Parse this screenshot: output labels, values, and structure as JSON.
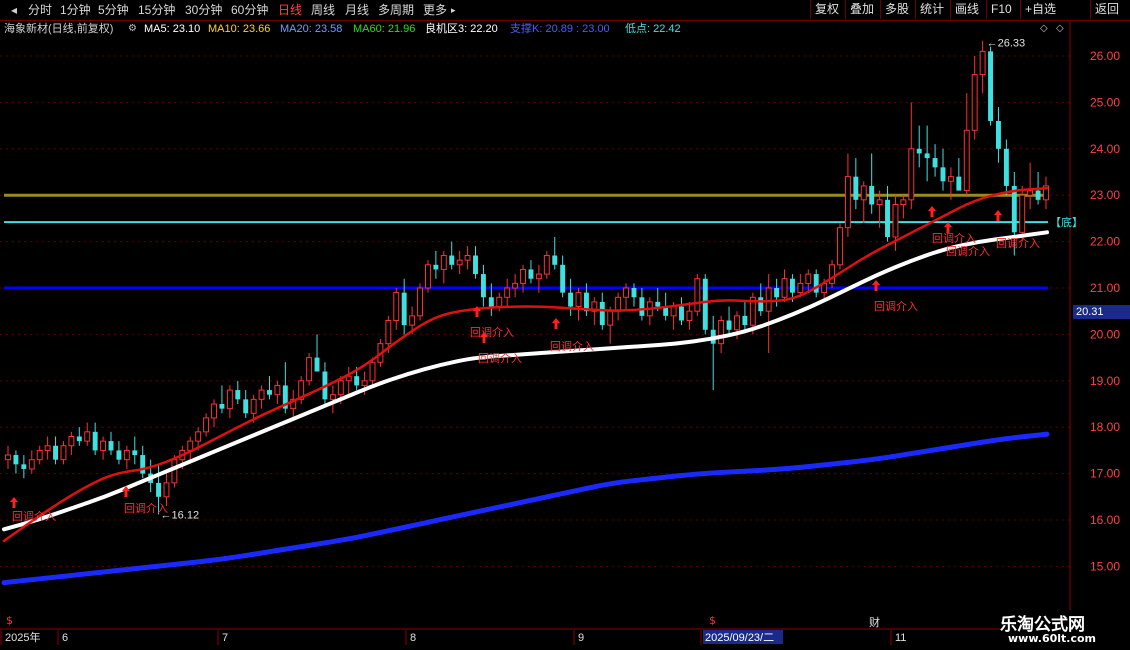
{
  "toolbar": {
    "tabs": [
      "分时",
      "1分钟",
      "5分钟",
      "15分钟",
      "30分钟",
      "60分钟",
      "日线",
      "周线",
      "月线",
      "多周期",
      "更多"
    ],
    "active_tab": "日线",
    "right_buttons": [
      "复权",
      "叠加",
      "多股",
      "统计",
      "画线",
      "F10",
      "+自选",
      "返回"
    ]
  },
  "info": {
    "stock": "海象新材(日线,前复权)",
    "ma5": "MA5: 23.10",
    "ma10": "MA10: 23.66",
    "ma20": "MA20: 23.58",
    "ma60": "MA60: 21.96",
    "liangji": "良机区3: 22.20",
    "support": "支撑K: 20.89 : 23.00",
    "dipoint": "低点: 22.42"
  },
  "colors": {
    "up": "#ff3030",
    "down": "#40e0e0",
    "ma_white": "#ffffff",
    "ma_red": "#e01010",
    "ma_blue": "#1a2aff",
    "line_olive": "#9a8a20",
    "line_cyan": "#40e0e0",
    "line_blue": "#0000ff",
    "axis": "#8b0000"
  },
  "chart_data": {
    "type": "candlestick",
    "y_ticks": [
      "26.00",
      "25.00",
      "24.00",
      "23.00",
      "22.00",
      "21.00",
      "20.00",
      "19.00",
      "18.00",
      "17.00",
      "16.00",
      "15.00"
    ],
    "ylim": [
      14.4,
      26.8
    ],
    "x_labels": [
      "2025年",
      "6",
      "7",
      "8",
      "9",
      "2025/09/23/二",
      "11"
    ],
    "high_label": "26.33",
    "low_label": "16.12",
    "current_price": "20.31",
    "horizontal_lines": [
      {
        "value": 23.0,
        "color": "olive"
      },
      {
        "value": 22.42,
        "color": "cyan",
        "label": "底"
      },
      {
        "value": 21.0,
        "color": "blue"
      }
    ],
    "signal_label": "回调介入",
    "special_markers": [
      "财"
    ],
    "candles": [
      [
        17.3,
        17.6,
        17.1,
        17.4
      ],
      [
        17.4,
        17.5,
        17.0,
        17.2
      ],
      [
        17.2,
        17.4,
        16.9,
        17.1
      ],
      [
        17.1,
        17.5,
        17.0,
        17.3
      ],
      [
        17.3,
        17.6,
        17.2,
        17.5
      ],
      [
        17.5,
        17.8,
        17.3,
        17.6
      ],
      [
        17.6,
        17.8,
        17.2,
        17.3
      ],
      [
        17.3,
        17.7,
        17.2,
        17.6
      ],
      [
        17.6,
        17.9,
        17.4,
        17.8
      ],
      [
        17.8,
        18.0,
        17.6,
        17.7
      ],
      [
        17.7,
        18.1,
        17.6,
        17.9
      ],
      [
        17.9,
        18.1,
        17.4,
        17.5
      ],
      [
        17.5,
        17.8,
        17.3,
        17.7
      ],
      [
        17.7,
        17.9,
        17.4,
        17.5
      ],
      [
        17.5,
        17.7,
        17.2,
        17.3
      ],
      [
        17.3,
        17.6,
        17.1,
        17.5
      ],
      [
        17.5,
        17.8,
        17.2,
        17.4
      ],
      [
        17.4,
        17.6,
        16.9,
        17.0
      ],
      [
        17.0,
        17.3,
        16.6,
        16.8
      ],
      [
        16.8,
        17.2,
        16.12,
        16.5
      ],
      [
        16.5,
        17.0,
        16.3,
        16.8
      ],
      [
        16.8,
        17.4,
        16.7,
        17.3
      ],
      [
        17.3,
        17.6,
        17.1,
        17.5
      ],
      [
        17.5,
        17.8,
        17.3,
        17.7
      ],
      [
        17.7,
        18.0,
        17.5,
        17.9
      ],
      [
        17.9,
        18.3,
        17.8,
        18.2
      ],
      [
        18.2,
        18.6,
        18.0,
        18.5
      ],
      [
        18.5,
        18.9,
        18.3,
        18.4
      ],
      [
        18.4,
        18.9,
        18.2,
        18.8
      ],
      [
        18.8,
        19.0,
        18.5,
        18.6
      ],
      [
        18.6,
        18.8,
        18.2,
        18.3
      ],
      [
        18.3,
        18.7,
        18.1,
        18.6
      ],
      [
        18.6,
        18.9,
        18.4,
        18.8
      ],
      [
        18.8,
        19.1,
        18.6,
        18.7
      ],
      [
        18.7,
        19.0,
        18.5,
        18.9
      ],
      [
        18.9,
        19.4,
        18.3,
        18.4
      ],
      [
        18.4,
        18.8,
        18.2,
        18.6
      ],
      [
        18.6,
        19.1,
        18.5,
        19.0
      ],
      [
        19.0,
        19.6,
        18.9,
        19.5
      ],
      [
        19.5,
        20.0,
        19.3,
        19.2
      ],
      [
        19.2,
        19.4,
        18.5,
        18.6
      ],
      [
        18.6,
        18.9,
        18.3,
        18.7
      ],
      [
        18.7,
        19.1,
        18.5,
        19.0
      ],
      [
        19.0,
        19.3,
        18.7,
        19.1
      ],
      [
        19.1,
        19.3,
        18.8,
        18.9
      ],
      [
        18.9,
        19.2,
        18.7,
        19.0
      ],
      [
        19.0,
        19.5,
        18.9,
        19.4
      ],
      [
        19.4,
        19.9,
        19.3,
        19.8
      ],
      [
        19.8,
        20.4,
        19.6,
        20.3
      ],
      [
        20.3,
        21.0,
        20.1,
        20.9
      ],
      [
        20.9,
        21.2,
        20.0,
        20.2
      ],
      [
        20.2,
        20.6,
        20.0,
        20.4
      ],
      [
        20.4,
        21.1,
        20.3,
        21.0
      ],
      [
        21.0,
        21.6,
        20.9,
        21.5
      ],
      [
        21.5,
        21.8,
        21.2,
        21.4
      ],
      [
        21.4,
        21.8,
        21.1,
        21.7
      ],
      [
        21.7,
        22.0,
        21.4,
        21.5
      ],
      [
        21.5,
        21.8,
        21.3,
        21.6
      ],
      [
        21.6,
        21.9,
        21.4,
        21.7
      ],
      [
        21.7,
        21.9,
        21.2,
        21.3
      ],
      [
        21.3,
        21.5,
        20.6,
        20.8
      ],
      [
        20.8,
        21.1,
        20.4,
        20.6
      ],
      [
        20.6,
        20.9,
        20.5,
        20.8
      ],
      [
        20.8,
        21.2,
        20.6,
        21.0
      ],
      [
        21.0,
        21.3,
        20.8,
        21.1
      ],
      [
        21.1,
        21.5,
        20.9,
        21.4
      ],
      [
        21.4,
        21.6,
        21.1,
        21.2
      ],
      [
        21.2,
        21.5,
        20.9,
        21.3
      ],
      [
        21.3,
        21.8,
        21.2,
        21.7
      ],
      [
        21.7,
        22.1,
        21.4,
        21.5
      ],
      [
        21.5,
        21.7,
        20.8,
        20.9
      ],
      [
        20.9,
        21.2,
        20.4,
        20.6
      ],
      [
        20.6,
        21.0,
        20.3,
        20.9
      ],
      [
        20.9,
        21.1,
        20.4,
        20.5
      ],
      [
        20.5,
        20.8,
        20.2,
        20.7
      ],
      [
        20.7,
        20.9,
        20.1,
        20.2
      ],
      [
        20.2,
        20.6,
        19.8,
        20.5
      ],
      [
        20.5,
        20.9,
        20.3,
        20.8
      ],
      [
        20.8,
        21.1,
        20.5,
        21.0
      ],
      [
        21.0,
        21.1,
        20.6,
        20.8
      ],
      [
        20.8,
        21.0,
        20.3,
        20.4
      ],
      [
        20.4,
        20.8,
        20.2,
        20.7
      ],
      [
        20.7,
        21.0,
        20.5,
        20.6
      ],
      [
        20.6,
        20.9,
        20.3,
        20.4
      ],
      [
        20.4,
        20.7,
        20.1,
        20.6
      ],
      [
        20.6,
        20.8,
        20.2,
        20.3
      ],
      [
        20.3,
        20.7,
        20.1,
        20.5
      ],
      [
        20.5,
        21.3,
        20.4,
        21.2
      ],
      [
        21.2,
        21.3,
        20.0,
        20.1
      ],
      [
        20.1,
        20.4,
        18.8,
        19.8
      ],
      [
        19.8,
        20.4,
        19.6,
        20.3
      ],
      [
        20.3,
        20.6,
        20.0,
        20.1
      ],
      [
        20.1,
        20.5,
        19.9,
        20.4
      ],
      [
        20.4,
        20.7,
        20.1,
        20.2
      ],
      [
        20.2,
        20.9,
        20.0,
        20.8
      ],
      [
        20.8,
        21.1,
        20.4,
        20.5
      ],
      [
        20.5,
        21.3,
        19.6,
        21.0
      ],
      [
        21.0,
        21.2,
        20.6,
        20.8
      ],
      [
        20.8,
        21.4,
        20.7,
        21.2
      ],
      [
        21.2,
        21.3,
        20.7,
        20.9
      ],
      [
        20.9,
        21.3,
        20.8,
        21.1
      ],
      [
        21.1,
        21.4,
        20.9,
        21.3
      ],
      [
        21.3,
        21.4,
        20.8,
        20.9
      ],
      [
        20.9,
        21.2,
        20.7,
        21.1
      ],
      [
        21.1,
        21.6,
        21.0,
        21.5
      ],
      [
        21.5,
        22.4,
        21.4,
        22.3
      ],
      [
        22.3,
        23.9,
        22.1,
        23.4
      ],
      [
        23.4,
        23.8,
        22.7,
        22.9
      ],
      [
        22.9,
        23.3,
        22.4,
        23.2
      ],
      [
        23.2,
        23.9,
        22.6,
        22.8
      ],
      [
        22.8,
        23.1,
        22.3,
        22.9
      ],
      [
        22.9,
        23.2,
        22.0,
        22.1
      ],
      [
        22.1,
        23.0,
        21.8,
        22.8
      ],
      [
        22.8,
        23.0,
        22.5,
        22.9
      ],
      [
        22.9,
        25.0,
        22.7,
        24.0
      ],
      [
        24.0,
        24.5,
        23.6,
        23.9
      ],
      [
        23.9,
        24.5,
        23.3,
        23.8
      ],
      [
        23.8,
        24.1,
        23.4,
        23.6
      ],
      [
        23.6,
        24.0,
        23.1,
        23.3
      ],
      [
        23.3,
        23.6,
        22.9,
        23.4
      ],
      [
        23.4,
        23.8,
        23.1,
        23.1
      ],
      [
        23.1,
        25.2,
        23.0,
        24.4
      ],
      [
        24.4,
        26.0,
        24.2,
        25.6
      ],
      [
        25.6,
        26.33,
        25.2,
        26.1
      ],
      [
        26.1,
        26.2,
        24.5,
        24.6
      ],
      [
        24.6,
        24.9,
        23.7,
        24.0
      ],
      [
        24.0,
        24.2,
        23.0,
        23.2
      ],
      [
        23.2,
        23.5,
        21.7,
        22.2
      ],
      [
        22.2,
        23.2,
        22.0,
        23.0
      ],
      [
        23.0,
        23.7,
        22.7,
        23.1
      ],
      [
        23.1,
        23.5,
        22.8,
        22.9
      ],
      [
        22.9,
        23.4,
        22.7,
        23.2
      ]
    ],
    "ma_white": [
      15.8,
      16.0,
      16.25,
      16.5,
      16.8,
      17.1,
      17.4,
      17.7,
      18.0,
      18.3,
      18.6,
      18.9,
      19.15,
      19.35,
      19.5,
      19.55,
      19.6,
      19.65,
      19.7,
      19.75,
      19.8,
      19.9,
      20.05,
      20.3,
      20.6,
      20.95,
      21.3,
      21.6,
      21.85,
      22.0,
      22.1,
      22.2
    ],
    "ma_red": [
      15.55,
      16.1,
      16.6,
      17.0,
      17.1,
      17.4,
      17.8,
      18.2,
      18.55,
      18.9,
      19.3,
      19.9,
      20.4,
      20.55,
      20.6,
      20.6,
      20.55,
      20.5,
      20.55,
      20.65,
      20.75,
      20.7,
      20.75,
      21.2,
      21.7,
      22.1,
      22.5,
      22.9,
      23.1,
      23.15
    ],
    "ma_blue": [
      14.65,
      14.75,
      14.85,
      14.95,
      15.05,
      15.15,
      15.3,
      15.45,
      15.6,
      15.8,
      16.0,
      16.2,
      16.4,
      16.6,
      16.8,
      16.9,
      17.0,
      17.05,
      17.1,
      17.2,
      17.3,
      17.45,
      17.6,
      17.75,
      17.85
    ]
  }
}
